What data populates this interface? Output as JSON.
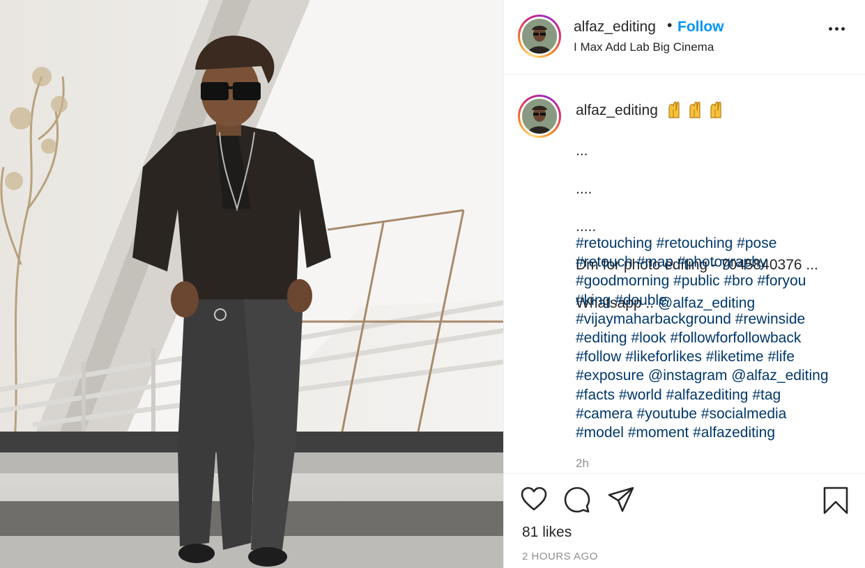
{
  "post": {
    "image_alt": "photo"
  },
  "header": {
    "username": "alfaz_editing",
    "separator": "•",
    "follow_label": "Follow",
    "location": "I Max Add Lab Big Cinema",
    "more_icon": "more-horizontal-icon"
  },
  "caption": {
    "username": "alfaz_editing",
    "emoji": "🙌🙌🙌",
    "lines": [
      "...",
      "....",
      ".....",
      "Dm for photo editing - 7045840376 ...",
      "Whatsapp .. @alfaz_editing"
    ],
    "hashtag_lines": [
      "#retouching #retouching #pose",
      "#retouch #map #photography",
      "#goodmorning #public #bro #foryou",
      "#king #double",
      "#vijaymaharbackground #rewinside",
      "#editing #look #followforfollowback",
      "#follow #likeforlikes #liketime #life",
      "#exposure @instagram @alfaz_editing",
      "#facts #world #alfazediting #tag",
      "#camera #youtube #socialmedia",
      "#model #moment #alfazediting"
    ],
    "time_ago": "2h"
  },
  "actions": {
    "icons": [
      "heart-icon",
      "comment-icon",
      "share-icon",
      "bookmark-icon"
    ],
    "likes": "81 likes",
    "timestamp": "2 HOURS AGO"
  },
  "colors": {
    "link": "#00376b",
    "follow": "#0095f6",
    "muted": "#8e8e8e",
    "text": "#262626"
  }
}
